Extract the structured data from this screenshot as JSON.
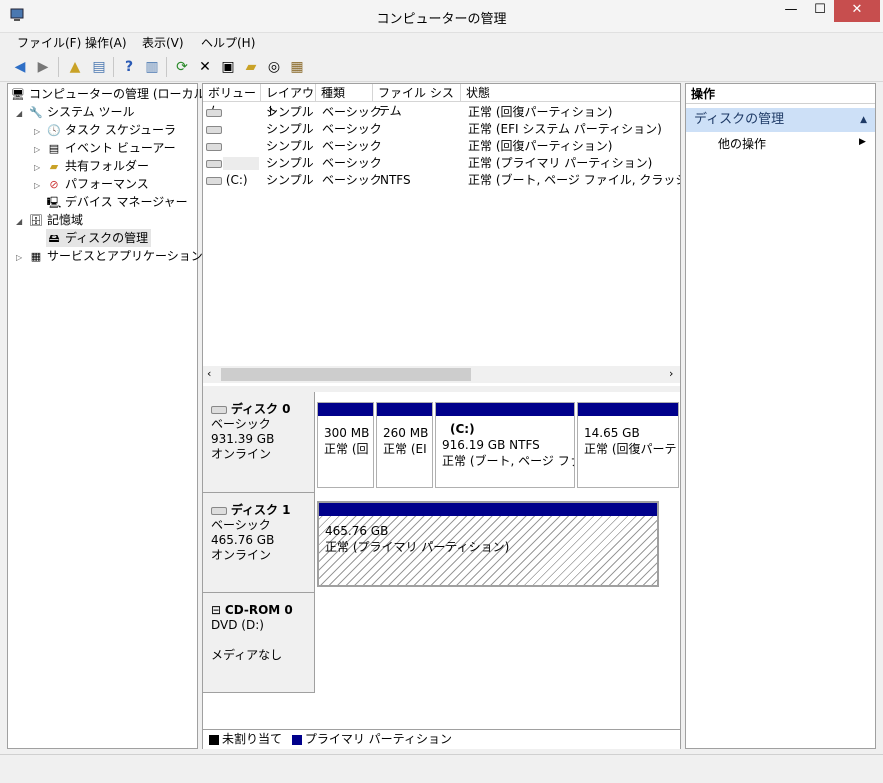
{
  "window": {
    "title": "コンピューターの管理",
    "minimize": "—",
    "maximize": "☐",
    "close": "✕"
  },
  "menu": [
    "ファイル(F)",
    "操作(A)",
    "表示(V)",
    "ヘルプ(H)"
  ],
  "tree": {
    "root": "コンピューターの管理 (ローカル)",
    "system_tools": "システム ツール",
    "task_scheduler": "タスク スケジューラ",
    "event_viewer": "イベント ビューアー",
    "shared_folders": "共有フォルダー",
    "performance": "パフォーマンス",
    "device_manager": "デバイス マネージャー",
    "storage": "記憶域",
    "disk_management": "ディスクの管理",
    "services_apps": "サービスとアプリケーション"
  },
  "volumes": {
    "headers": [
      "ボリューム",
      "レイアウト",
      "種類",
      "ファイル システム",
      "状態"
    ],
    "rows": [
      {
        "volume": "",
        "layout": "シンプル",
        "type": "ベーシック",
        "fs": "",
        "status": "正常 (回復パーティション)"
      },
      {
        "volume": "",
        "layout": "シンプル",
        "type": "ベーシック",
        "fs": "",
        "status": "正常 (EFI システム パーティション)"
      },
      {
        "volume": "",
        "layout": "シンプル",
        "type": "ベーシック",
        "fs": "",
        "status": "正常 (回復パーティション)"
      },
      {
        "volume": "",
        "layout": "シンプル",
        "type": "ベーシック",
        "fs": "",
        "status": "正常 (プライマリ パーティション)"
      },
      {
        "volume": "(C:)",
        "layout": "シンプル",
        "type": "ベーシック",
        "fs": "NTFS",
        "status": "正常 (ブート, ページ ファイル, クラッシュ ダンプ"
      }
    ]
  },
  "disks": {
    "disk0": {
      "name": "ディスク 0",
      "kind": "ベーシック",
      "size": "931.39 GB",
      "state": "オンライン",
      "parts": [
        {
          "title": "",
          "size": "300 MB",
          "status": "正常 (回"
        },
        {
          "title": "",
          "size": "260 MB",
          "status": "正常 (EI"
        },
        {
          "title": "(C:)",
          "size": "916.19 GB NTFS",
          "status": "正常 (ブート, ページ ファイ"
        },
        {
          "title": "",
          "size": "14.65 GB",
          "status": "正常 (回復パーテ"
        }
      ]
    },
    "disk1": {
      "name": "ディスク 1",
      "kind": "ベーシック",
      "size": "465.76 GB",
      "state": "オンライン",
      "parts": [
        {
          "title": "",
          "size": "465.76 GB",
          "status": "正常 (プライマリ パーティション)"
        }
      ]
    },
    "cdrom": {
      "name": "CD-ROM 0",
      "kind": "DVD (D:)",
      "state": "メディアなし"
    }
  },
  "legend": {
    "unallocated": "未割り当て",
    "primary": "プライマリ パーティション"
  },
  "actions": {
    "header": "操作",
    "section": "ディスクの管理",
    "more": "他の操作"
  },
  "colors": {
    "partition_bar": "#00008b",
    "selection": "#cde0f7"
  }
}
